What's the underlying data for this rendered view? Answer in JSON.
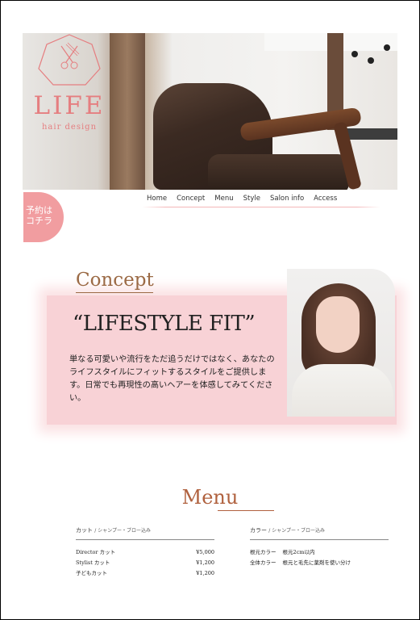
{
  "brand": {
    "name": "LIFE",
    "tagline": "hair design"
  },
  "reserve": {
    "line1": "予約は",
    "line2": "コチラ"
  },
  "nav": [
    "Home",
    "Concept",
    "Menu",
    "Style",
    "Salon info",
    "Access"
  ],
  "concept": {
    "title": "Concept",
    "headline": "“LIFESTYLE FIT”",
    "body": "単なる可愛いや流行をただ追うだけではなく、あなたのライフスタイルにフィットするスタイルをご提供します。日常でも再現性の高いヘアーを体感してみてください。"
  },
  "menu": {
    "title": "Menu",
    "cut": {
      "heading": "カット",
      "heading_note": "/ シャンプー・ブロー込み",
      "items": [
        {
          "name": "Director カット",
          "price": "¥5,000"
        },
        {
          "name": "Stylist カット",
          "price": "¥1,200"
        },
        {
          "name": "子どもカット",
          "price": "¥1,200"
        }
      ]
    },
    "color": {
      "heading": "カラー",
      "heading_note": "/ シャンプー・ブロー込み",
      "items": [
        {
          "name": "根元カラー",
          "price": "根元2cm以内"
        },
        {
          "name": "全体カラー",
          "price": "根元と毛先に薬剤を使い分け"
        }
      ]
    }
  },
  "colors": {
    "accent_pink": "#f19da0",
    "brand_rose": "#e57e80",
    "brown": "#9b6a45"
  }
}
